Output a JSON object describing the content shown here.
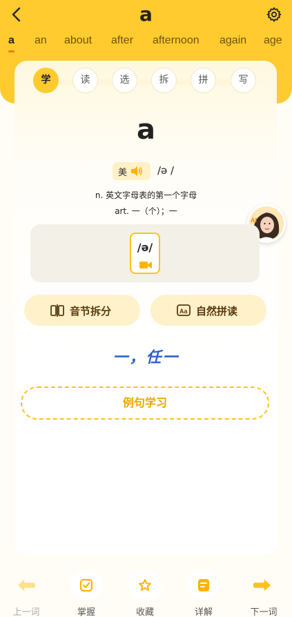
{
  "header": {
    "word": "a",
    "colors": {
      "accent": "#FFCB2E",
      "accent_dark": "#f0a500",
      "underline": "#f07a12"
    }
  },
  "word_tabs": [
    "a",
    "an",
    "about",
    "after",
    "afternoon",
    "again",
    "age"
  ],
  "modes": [
    "学",
    "读",
    "选",
    "拆",
    "拼",
    "写"
  ],
  "active_mode": "学",
  "word_card": {
    "word": "a",
    "accent_label": "美",
    "phonetic": "/ə /",
    "definitions": [
      "n. 英文字母表的第一个字母",
      "art. 一（个）；一"
    ],
    "phoneme": "/ə/",
    "features": [
      {
        "label": "音节拆分",
        "icon": "syllable-split-icon"
      },
      {
        "label": "自然拼读",
        "icon": "phonics-icon"
      }
    ],
    "handwriting_meaning": "一，任一",
    "example_button": "例句学习"
  },
  "bottom_nav": {
    "prev": "上一词",
    "master": "掌握",
    "favorite": "收藏",
    "detail": "详解",
    "next": "下一词"
  }
}
